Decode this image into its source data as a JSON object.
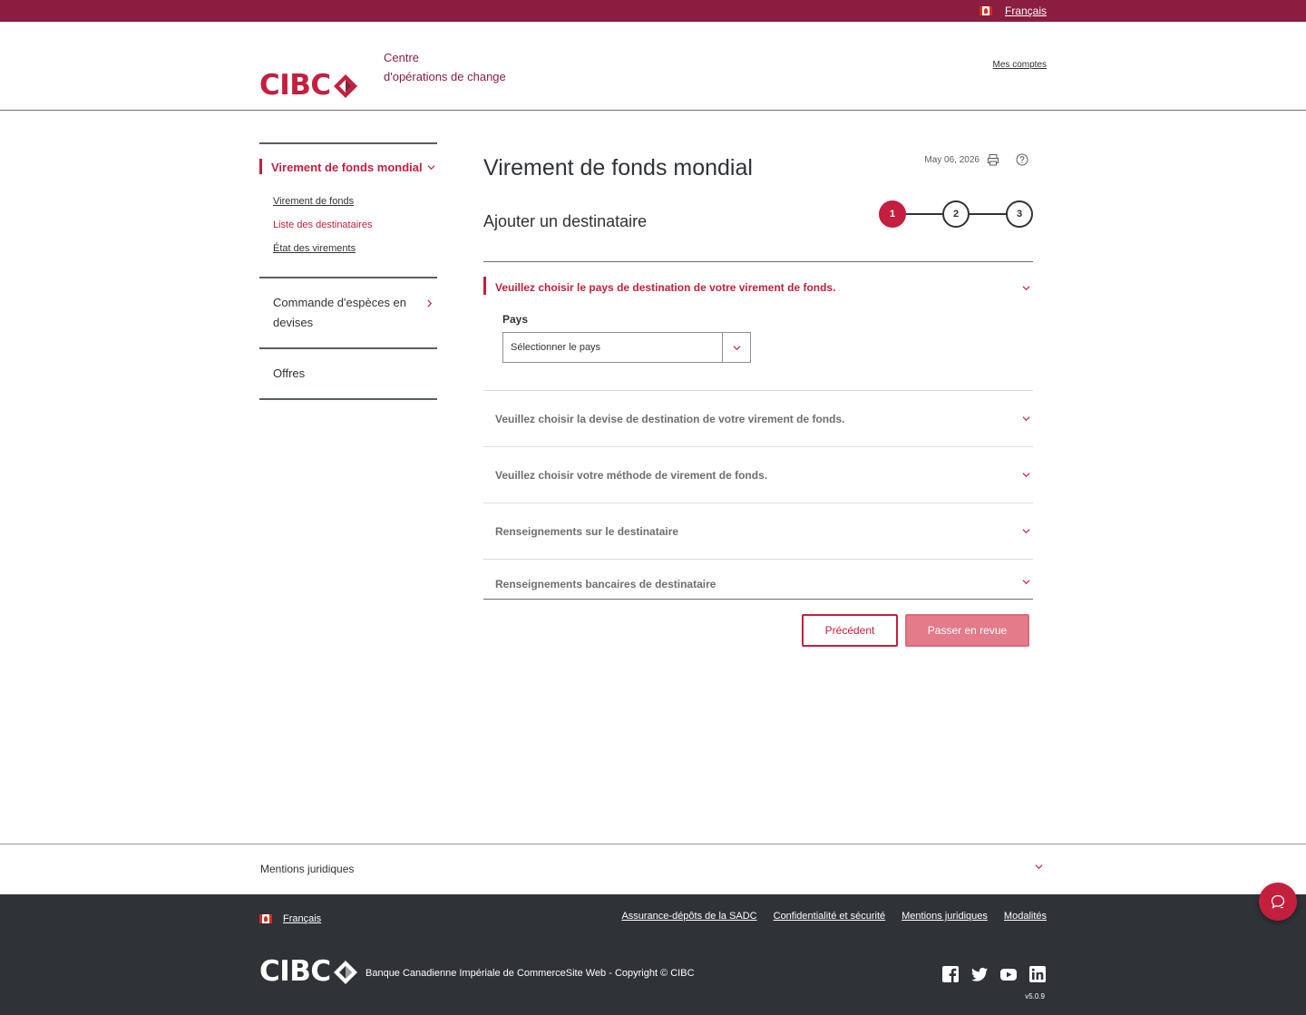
{
  "colors": {
    "brand": "#c41f3e",
    "topbar": "#8b1d41",
    "footer": "#2f3237",
    "disabled_button": "#e37b8b"
  },
  "topbar": {
    "language": "Français"
  },
  "header": {
    "logo": "CIBC",
    "centre_line1": "Centre",
    "centre_line2": "d'opérations de change",
    "my_accounts": "Mes comptes"
  },
  "sidebar": {
    "active_section": "Virement de fonds mondial",
    "subitems": [
      "Virement de fonds",
      "Liste des destinataires",
      "État des virements"
    ],
    "item_orders": "Commande d'espèces en devises",
    "item_offers": "Offres"
  },
  "main": {
    "title": "Virement de fonds mondial",
    "date": "May 06, 2026",
    "subtitle": "Ajouter un destinataire",
    "steps": [
      "1",
      "2",
      "3"
    ],
    "active_step": 1
  },
  "accordion": {
    "country_heading": "Veuillez choisir le pays de destination de votre virement de fonds.",
    "country_label": "Pays",
    "country_placeholder": "Sélectionner le pays",
    "currency_heading": "Veuillez choisir la devise de destination de votre virement de fonds.",
    "method_heading": "Veuillez choisir votre méthode de virement de fonds.",
    "recipient_heading": "Renseignements sur le destinataire",
    "bank_heading": "Renseignements bancaires de destinataire"
  },
  "buttons": {
    "previous": "Précédent",
    "review": "Passer en revue"
  },
  "legal": {
    "title": "Mentions juridiques"
  },
  "footer": {
    "language": "Français",
    "links": [
      "Assurance-dépôts de la SADC",
      "Confidentialité et sécurité",
      "Mentions juridiques",
      "Modalités"
    ],
    "logo": "CIBC",
    "copyright": "Banque Canadienne Impériale de CommerceSite Web - Copyright © CIBC",
    "version": "v5.0.9",
    "social_icons": [
      "facebook-icon",
      "twitter-icon",
      "youtube-icon",
      "linkedin-icon"
    ]
  }
}
